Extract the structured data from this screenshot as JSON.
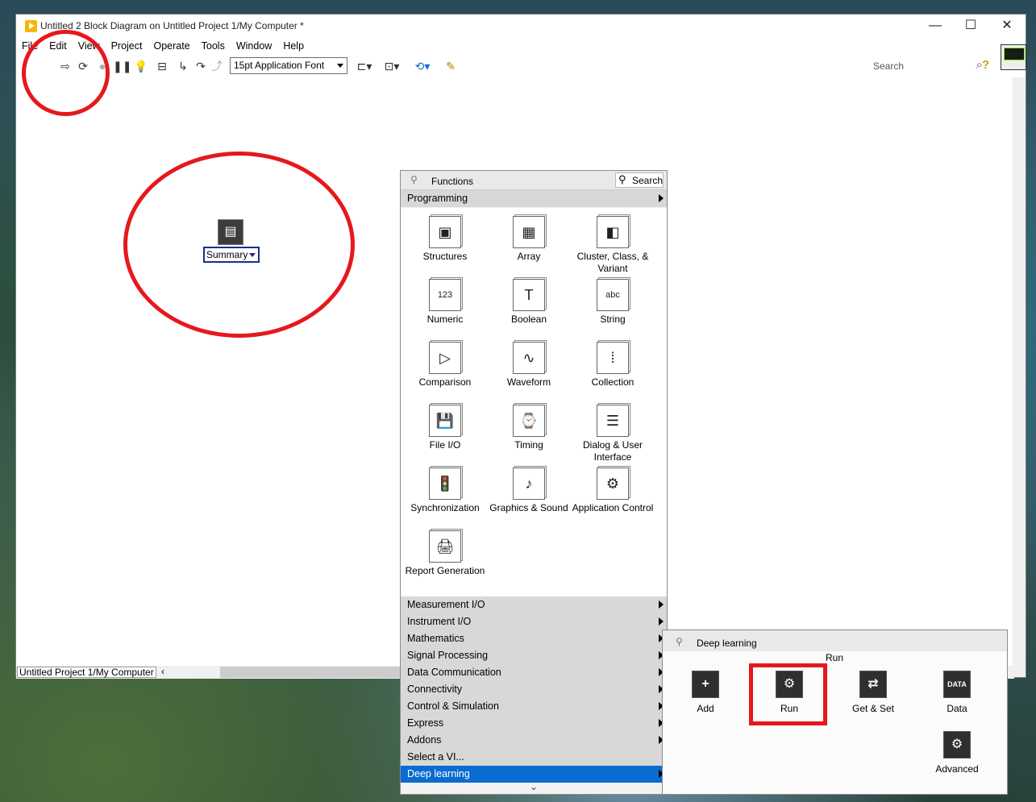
{
  "window": {
    "title": "Untitled 2 Block Diagram on Untitled Project 1/My Computer *",
    "controls": [
      "—",
      "☐",
      "✕"
    ]
  },
  "menu": [
    "File",
    "Edit",
    "View",
    "Project",
    "Operate",
    "Tools",
    "Window",
    "Help"
  ],
  "toolbar": {
    "font": "15pt Application Font",
    "search_placeholder": "Search",
    "icons": [
      "run-arrow-icon",
      "run-continuously-icon",
      "abort-icon",
      "pause-icon",
      "highlight-execution-icon",
      "retain-wire-values-icon",
      "step-into-icon",
      "step-over-icon",
      "step-out-icon",
      "align-icon",
      "distribute-icon",
      "reorder-icon",
      "cleanup-diagram-icon",
      "search-icon",
      "help-icon"
    ]
  },
  "status": {
    "context": "Untitled Project 1/My Computer"
  },
  "node": {
    "label": "Summary"
  },
  "palette": {
    "title": "Functions",
    "search": "Search",
    "top_category": "Programming",
    "items": [
      {
        "label": "Structures",
        "icon": "structures-icon",
        "glyph": "▣"
      },
      {
        "label": "Array",
        "icon": "array-icon",
        "glyph": "▦"
      },
      {
        "label": "Cluster, Class, & Variant",
        "icon": "cluster-icon",
        "glyph": "◧"
      },
      {
        "label": "Numeric",
        "icon": "numeric-icon",
        "glyph": "123"
      },
      {
        "label": "Boolean",
        "icon": "boolean-icon",
        "glyph": "T"
      },
      {
        "label": "String",
        "icon": "string-icon",
        "glyph": "abc"
      },
      {
        "label": "Comparison",
        "icon": "comparison-icon",
        "glyph": "▷"
      },
      {
        "label": "Waveform",
        "icon": "waveform-icon",
        "glyph": "∿"
      },
      {
        "label": "Collection",
        "icon": "collection-icon",
        "glyph": "⁞"
      },
      {
        "label": "File I/O",
        "icon": "file-io-icon",
        "glyph": "💾"
      },
      {
        "label": "Timing",
        "icon": "timing-icon",
        "glyph": "⌚"
      },
      {
        "label": "Dialog & User Interface",
        "icon": "dialog-icon",
        "glyph": "☰"
      },
      {
        "label": "Synchronization",
        "icon": "synchronization-icon",
        "glyph": "🚦"
      },
      {
        "label": "Graphics & Sound",
        "icon": "graphics-icon",
        "glyph": "♪"
      },
      {
        "label": "Application Control",
        "icon": "application-control-icon",
        "glyph": "⚙"
      },
      {
        "label": "Report Generation",
        "icon": "report-icon",
        "glyph": "🖨"
      }
    ],
    "categories": [
      "Measurement I/O",
      "Instrument I/O",
      "Mathematics",
      "Signal Processing",
      "Data Communication",
      "Connectivity",
      "Control & Simulation",
      "Express",
      "Addons",
      "Select a VI...",
      "Deep learning"
    ],
    "selected_category": "Deep learning",
    "more": "⌄"
  },
  "subpalette": {
    "title": "Deep learning",
    "tooltip": "Run",
    "items": [
      {
        "label": "Add",
        "icon": "add-icon",
        "glyph": "+"
      },
      {
        "label": "Run",
        "icon": "run-gears-icon",
        "glyph": "⚙"
      },
      {
        "label": "Get & Set",
        "icon": "get-set-icon",
        "glyph": "⇄"
      },
      {
        "label": "Data",
        "icon": "data-icon",
        "glyph": "DATA"
      },
      {
        "label": "Advanced",
        "icon": "advanced-icon",
        "glyph": "⚙"
      }
    ]
  },
  "colors": {
    "highlight": "#0a6cd0",
    "annotation": "#e6181d"
  }
}
